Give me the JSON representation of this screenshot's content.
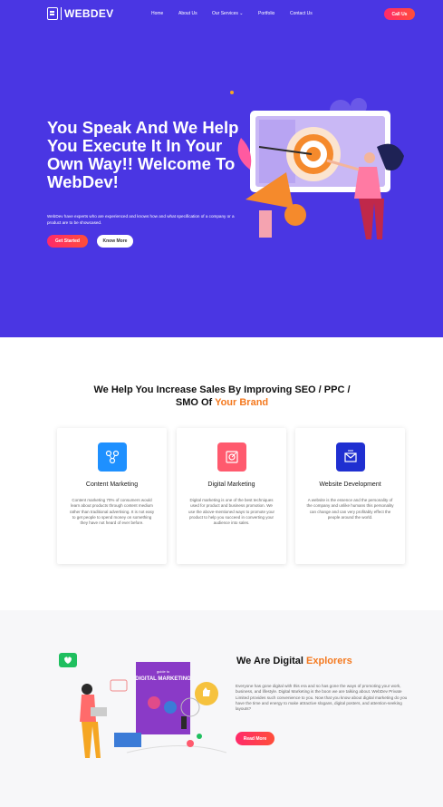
{
  "nav": {
    "brand": "WEBDEV",
    "links": [
      "Home",
      "About Us",
      "Our Services ⌄",
      "Portfolio",
      "Contact Us"
    ],
    "cta": "Call Us"
  },
  "hero": {
    "title": "You Speak And We Help You Execute It In Your Own Way!! Welcome To WebDev!",
    "description": "WebDev have experts who are experienced and knows how and what specification of a company or a product are to be showcased.",
    "primary_button": "Get Started",
    "secondary_button": "Know More",
    "background_color": "#4a36e3"
  },
  "services": {
    "title_main": "We Help You Increase Sales By Improving SEO / PPC / SMO Of ",
    "title_accent": "Your Brand",
    "cards": [
      {
        "title": "Content Marketing",
        "description": "Content marketing 70% of consumers would learn about products through content medium rather than traditional advertising. It is not easy to get people to spend money on something they have not heard of ever before.",
        "icon": "content-marketing-icon",
        "icon_color": "#1e90ff"
      },
      {
        "title": "Digital Marketing",
        "description": "Digital marketing is one of the best techniques used for product and business promotion. We use the above-mentioned ways to promote your product to help you succeed in converting your audience into sales.",
        "icon": "digital-marketing-icon",
        "icon_color": "#ff5a6e"
      },
      {
        "title": "Website Development",
        "description": "A website is the essence and the personality of the company and unlike humans this personality can change and can very profitably effect the people around the world.",
        "icon": "website-development-icon",
        "icon_color": "#1f2fd1"
      }
    ]
  },
  "explorers": {
    "title_main": "We Are Digital ",
    "title_accent": "Explorers",
    "description": "Everyone has gone digital with this era and so has gone the ways of promoting your work, business, and lifestyle. Digital Marketing is the boon we are talking about. WebDev Private Limited provides such convenience to you. Now that you know about digital marketing do you have the time and energy to make attractive slogans, digital posters, and attention-seeking layouts?",
    "button": "Read More",
    "book_small": "guide to",
    "book_title": "DIGITAL MARKETING"
  },
  "colors": {
    "accent": "#f4791f",
    "button_gradient_start": "#ff2a6a",
    "button_gradient_end": "#ff4e3a"
  }
}
